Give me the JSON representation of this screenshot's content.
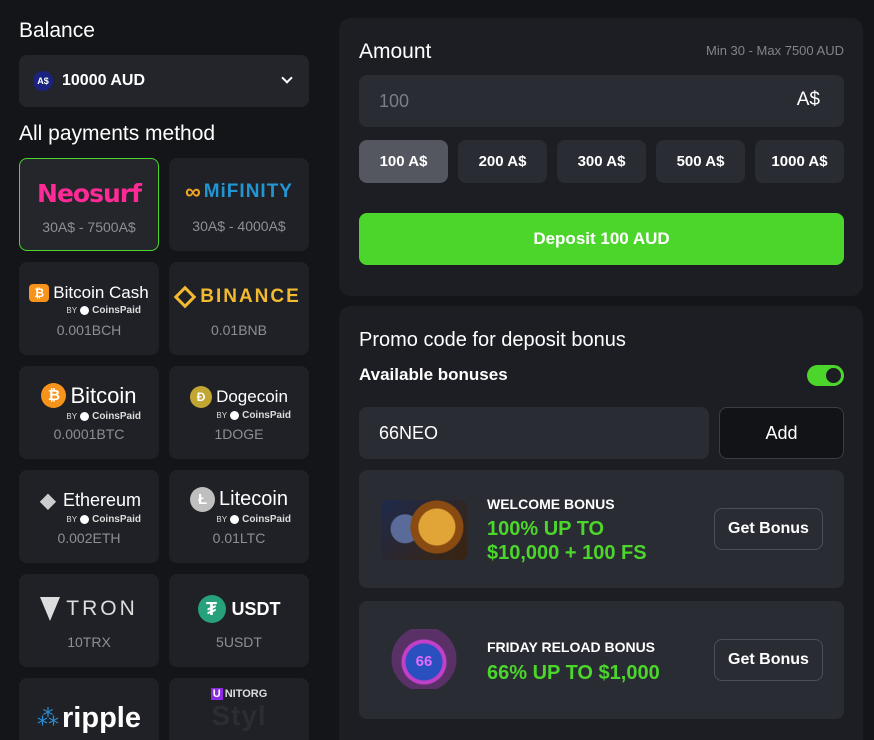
{
  "balance": {
    "heading": "Balance",
    "currency_badge": "A$",
    "value": "10000 AUD",
    "icon": "chevron-down-icon"
  },
  "payments": {
    "heading": "All payments method",
    "methods": [
      {
        "name": "Neosurf",
        "limit": "30A$ - 7500A$",
        "selected": true
      },
      {
        "name": "MiFINITY",
        "limit": "30A$ - 4000A$"
      },
      {
        "name": "Bitcoin Cash",
        "by": "BY",
        "provider": "CoinsPaid",
        "limit": "0.001BCH"
      },
      {
        "name": "BINANCE",
        "limit": "0.01BNB"
      },
      {
        "name": "Bitcoin",
        "by": "BY",
        "provider": "CoinsPaid",
        "limit": "0.0001BTC"
      },
      {
        "name": "Dogecoin",
        "by": "BY",
        "provider": "CoinsPaid",
        "limit": "1DOGE"
      },
      {
        "name": "Ethereum",
        "by": "BY",
        "provider": "CoinsPaid",
        "limit": "0.002ETH"
      },
      {
        "name": "Litecoin",
        "by": "BY",
        "provider": "CoinsPaid",
        "limit": "0.01LTC"
      },
      {
        "name": "TRON",
        "limit": "10TRX"
      },
      {
        "name": "USDT",
        "limit": "5USDT"
      },
      {
        "name": "ripple"
      },
      {
        "name": "UNITORG",
        "name_prefix": "U",
        "name_rest": "NITORG",
        "sub": "Styl"
      }
    ]
  },
  "amount": {
    "heading": "Amount",
    "minmax": "Min 30 - Max 7500 AUD",
    "placeholder": "100",
    "currency": "A$",
    "presets": [
      "100 A$",
      "200 A$",
      "300 A$",
      "500 A$",
      "1000 A$"
    ],
    "selected_preset": 0,
    "deposit_label": "Deposit 100 AUD"
  },
  "promo": {
    "heading": "Promo code for deposit bonus",
    "available_label": "Available bonuses",
    "toggle_on": true,
    "code_value": "66NEO",
    "add_label": "Add",
    "bonuses": [
      {
        "title": "WELCOME BONUS",
        "line1": "100% UP TO",
        "line2": "$10,000 + 100 FS",
        "button": "Get Bonus"
      },
      {
        "title": "FRIDAY RELOAD BONUS",
        "line1": "66% UP TO $1,000",
        "button": "Get Bonus",
        "badge_text": "66"
      }
    ]
  },
  "colors": {
    "accent_green": "#4cd62b",
    "neosurf_pink": "#ff2a96",
    "binance_yellow": "#f3ba2f",
    "usdt_green": "#26a17b",
    "bitcoin_orange": "#f7931a"
  }
}
